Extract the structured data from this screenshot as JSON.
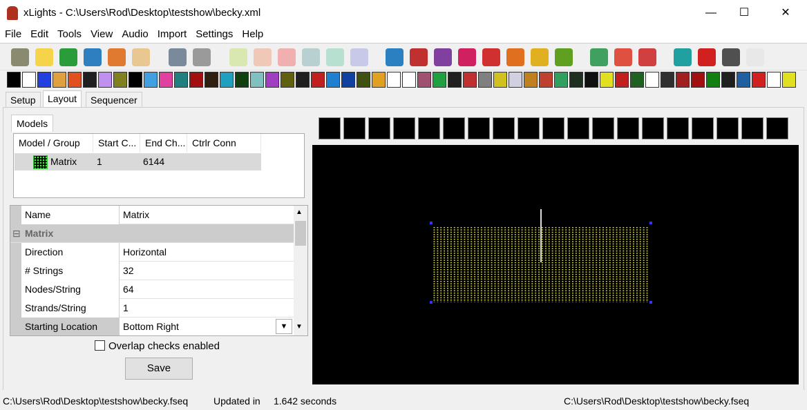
{
  "window": {
    "title": "xLights - C:\\Users\\Rod\\Desktop\\testshow\\becky.xml",
    "minimize": "—",
    "maximize": "☐",
    "close": "✕"
  },
  "menu": [
    "File",
    "Edit",
    "Tools",
    "View",
    "Audio",
    "Import",
    "Settings",
    "Help"
  ],
  "toolbar_icons": [
    {
      "name": "open-show-folder-icon",
      "color": "#8a8a70"
    },
    {
      "name": "new-sequence-icon",
      "color": "#f5d44a"
    },
    {
      "name": "open-sequence-icon",
      "color": "#2a9d3a"
    },
    {
      "name": "save-icon",
      "color": "#2e7fc0"
    },
    {
      "name": "save-as-icon",
      "color": "#e07a30"
    },
    {
      "name": "color-palette-icon",
      "color": "#e8c890"
    },
    {
      "name": "timing-icon",
      "color": "#7a8a9a"
    },
    {
      "name": "calculator-icon",
      "color": "#9a9a9a"
    },
    {
      "name": "play-icon",
      "color": "#d8e8b0"
    },
    {
      "name": "pause-icon",
      "color": "#f0c8b8"
    },
    {
      "name": "stop-icon",
      "color": "#f0b0b0"
    },
    {
      "name": "rewind-icon",
      "color": "#b8d0d0"
    },
    {
      "name": "fast-forward-icon",
      "color": "#b8e0d0"
    },
    {
      "name": "replay-icon",
      "color": "#c8c8e8"
    },
    {
      "name": "settings-gear-icon",
      "color": "#2a80c0"
    },
    {
      "name": "crayons-icon",
      "color": "#c03030"
    },
    {
      "name": "package-icon",
      "color": "#8040a0"
    },
    {
      "name": "layers-icon",
      "color": "#d02060"
    },
    {
      "name": "effect-a-icon",
      "color": "#d03030"
    },
    {
      "name": "house-icon",
      "color": "#e07020"
    },
    {
      "name": "ladder-icon",
      "color": "#e0b020"
    },
    {
      "name": "chip-icon",
      "color": "#60a020"
    },
    {
      "name": "zoom-in-icon",
      "color": "#40a060"
    },
    {
      "name": "zoom-out-icon",
      "color": "#e05040"
    },
    {
      "name": "restore-icon",
      "color": "#d04040"
    },
    {
      "name": "help-icon",
      "color": "#20a0a0"
    },
    {
      "name": "stop-sign-icon",
      "color": "#d02020"
    },
    {
      "name": "bulb-off-icon",
      "color": "#505050"
    },
    {
      "name": "bulb-on-icon",
      "color": "#e8e8e8"
    }
  ],
  "effect_icons": [
    {
      "name": "off-effect-icon",
      "color": "#000"
    },
    {
      "name": "on-effect-icon",
      "color": "#fff"
    },
    {
      "name": "bars-effect-icon",
      "color": "#2040e0"
    },
    {
      "name": "butterfly-effect-icon",
      "color": "#e0a040"
    },
    {
      "name": "candle-effect-icon",
      "color": "#e05020"
    },
    {
      "name": "circles-effect-icon",
      "color": "#202020"
    },
    {
      "name": "color-wash-effect-icon",
      "color": "#c090f0"
    },
    {
      "name": "curtain-effect-icon",
      "color": "#808020"
    },
    {
      "name": "dmx-effect-icon",
      "color": "#000"
    },
    {
      "name": "faces-effect-icon",
      "color": "#40a0e0"
    },
    {
      "name": "fan-effect-icon",
      "color": "#e040a0"
    },
    {
      "name": "fill-effect-icon",
      "color": "#208080"
    },
    {
      "name": "fire-effect-icon",
      "color": "#a01010"
    },
    {
      "name": "fireworks-effect-icon",
      "color": "#302010"
    },
    {
      "name": "galaxy-effect-icon",
      "color": "#20a0c0"
    },
    {
      "name": "garlands-effect-icon",
      "color": "#104010"
    },
    {
      "name": "glediator-effect-icon",
      "color": "#80c0c0"
    },
    {
      "name": "kaleidoscope-effect-icon",
      "color": "#a040c0"
    },
    {
      "name": "life-effect-icon",
      "color": "#606010"
    },
    {
      "name": "lightning-effect-icon",
      "color": "#202020"
    },
    {
      "name": "lines-effect-icon",
      "color": "#c02020"
    },
    {
      "name": "liquid-effect-icon",
      "color": "#2080d0"
    },
    {
      "name": "marquee-effect-icon",
      "color": "#1040a0"
    },
    {
      "name": "meteors-effect-icon",
      "color": "#405010"
    },
    {
      "name": "morph-effect-icon",
      "color": "#e0a020"
    },
    {
      "name": "music-effect-icon",
      "color": "#fff"
    },
    {
      "name": "piano-effect-icon",
      "color": "#fff"
    },
    {
      "name": "pictures-effect-icon",
      "color": "#a05070"
    },
    {
      "name": "pinwheel-effect-icon",
      "color": "#20a040"
    },
    {
      "name": "plasma-effect-icon",
      "color": "#202020"
    },
    {
      "name": "ripple-effect-icon",
      "color": "#c03030"
    },
    {
      "name": "servo-effect-icon",
      "color": "#808080"
    },
    {
      "name": "shader-effect-icon",
      "color": "#d0c020"
    },
    {
      "name": "shape-effect-icon",
      "color": "#d0d0e0"
    },
    {
      "name": "shimmer-effect-icon",
      "color": "#c08020"
    },
    {
      "name": "shockwave-effect-icon",
      "color": "#c04030"
    },
    {
      "name": "single-strand-effect-icon",
      "color": "#30a060"
    },
    {
      "name": "sketch-effect-icon",
      "color": "#203020"
    },
    {
      "name": "snowflakes-effect-icon",
      "color": "#101010"
    },
    {
      "name": "snowstorm-effect-icon",
      "color": "#e0e020"
    },
    {
      "name": "spirals-effect-icon",
      "color": "#c02020"
    },
    {
      "name": "spirograph-effect-icon",
      "color": "#206020"
    },
    {
      "name": "state-effect-icon",
      "color": "#fff"
    },
    {
      "name": "strobe-effect-icon",
      "color": "#303030"
    },
    {
      "name": "tendril-effect-icon",
      "color": "#a02020"
    },
    {
      "name": "text-effect-icon",
      "color": "#a01010"
    },
    {
      "name": "tree-effect-icon",
      "color": "#108010"
    },
    {
      "name": "twinkle-effect-icon",
      "color": "#202020"
    },
    {
      "name": "video-effect-icon",
      "color": "#2060a0"
    },
    {
      "name": "vu-meter-effect-icon",
      "color": "#d02020"
    },
    {
      "name": "warp-effect-icon",
      "color": "#fff"
    },
    {
      "name": "wave-effect-icon",
      "color": "#e0e020"
    }
  ],
  "tabs": {
    "setup": "Setup",
    "layout": "Layout",
    "sequencer": "Sequencer"
  },
  "models": {
    "tab": "Models",
    "columns": [
      "Model / Group",
      "Start C...",
      "End Ch...",
      "Ctrlr Conn"
    ],
    "rows": [
      {
        "name": "Matrix",
        "start": "1",
        "end": "6144",
        "ctrlr": ""
      }
    ]
  },
  "properties": {
    "name_label": "Name",
    "name_value": "Matrix",
    "section": "Matrix",
    "rows": [
      {
        "label": "Direction",
        "value": "Horizontal"
      },
      {
        "label": "# Strings",
        "value": "32"
      },
      {
        "label": "Nodes/String",
        "value": "64"
      },
      {
        "label": "Strands/String",
        "value": "1"
      },
      {
        "label": "Starting Location",
        "value": "Bottom Right"
      }
    ]
  },
  "overlap_label": "Overlap checks enabled",
  "overlap_checked": false,
  "save_label": "Save",
  "model_shapes": [
    "arches-icon",
    "candy-canes-icon",
    "channel-block-icon",
    "circle-icon",
    "cube-icon",
    "custom-icon",
    "dmx-icon",
    "image-icon",
    "icicles-icon",
    "matrix-icon",
    "single-line-icon",
    "poly-line-icon",
    "sphere-icon",
    "star-burst-icon",
    "star-icon",
    "tree-icon",
    "window-frame-icon",
    "wreath-icon",
    "import-icon"
  ],
  "matrix_color": "#e8e830",
  "status": {
    "left": "C:\\Users\\Rod\\Desktop\\testshow\\becky.fseq",
    "updated": "Updated in",
    "time": "1.642 seconds",
    "right": "C:\\Users\\Rod\\Desktop\\testshow\\becky.fseq"
  }
}
